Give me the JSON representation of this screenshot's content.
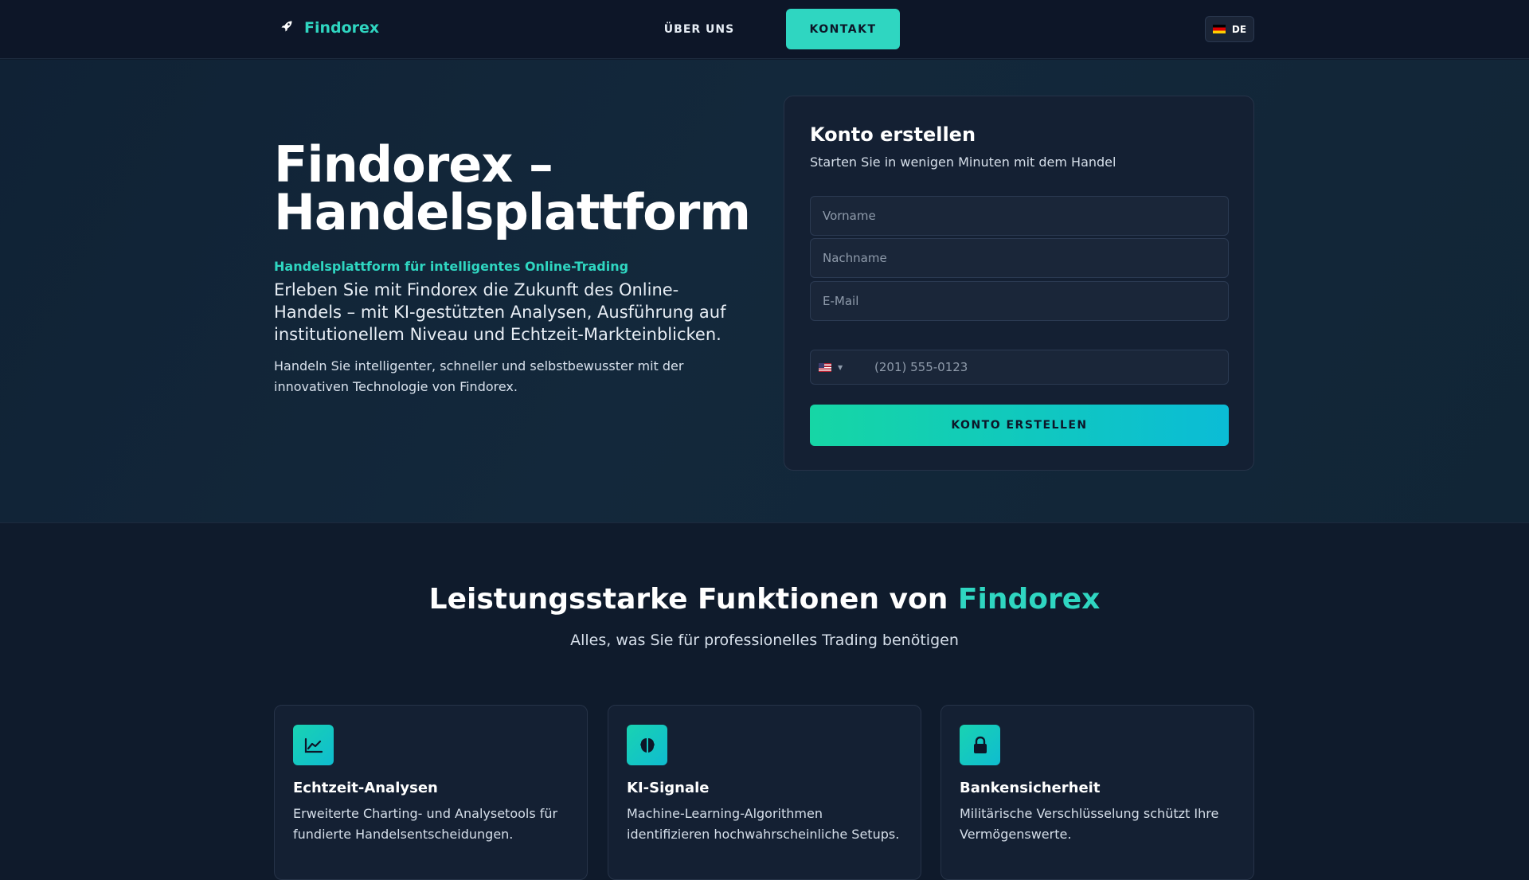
{
  "header": {
    "brand": "Findorex",
    "nav_about": "ÜBER UNS",
    "nav_contact": "KONTAKT",
    "language": "DE"
  },
  "hero": {
    "title": "Findorex – Handelsplattform",
    "tagline": "Handelsplattform für intelligentes Online-Trading",
    "lead": "Erleben Sie mit Findorex die Zukunft des Online-Handels – mit KI-gestützten Analysen, Ausführung auf institutionellem Niveau und Echtzeit-Markteinblicken.",
    "small": "Handeln Sie intelligenter, schneller und selbstbewusster mit der innovativen Technologie von Findorex."
  },
  "form": {
    "title": "Konto erstellen",
    "subtitle": "Starten Sie in wenigen Minuten mit dem Handel",
    "first_name_placeholder": "Vorname",
    "last_name_placeholder": "Nachname",
    "email_placeholder": "E-Mail",
    "phone_placeholder": "(201) 555-0123",
    "submit_label": "KONTO ERSTELLEN"
  },
  "features": {
    "title_prefix": "Leistungsstarke Funktionen von ",
    "title_accent": "Findorex",
    "subtitle": "Alles, was Sie für professionelles Trading benötigen",
    "cards": [
      {
        "icon": "chart-line-icon",
        "title": "Echtzeit-Analysen",
        "text": "Erweiterte Charting- und Analysetools für fundierte Handelsentscheidungen."
      },
      {
        "icon": "brain-icon",
        "title": "KI-Signale",
        "text": "Machine-Learning-Algorithmen identifizieren hochwahrscheinliche Setups."
      },
      {
        "icon": "lock-icon",
        "title": "Bankensicherheit",
        "text": "Militärische Verschlüsselung schützt Ihre Vermögenswerte."
      }
    ]
  },
  "colors": {
    "accent": "#2fd6c1",
    "background": "#0f1a2b"
  }
}
